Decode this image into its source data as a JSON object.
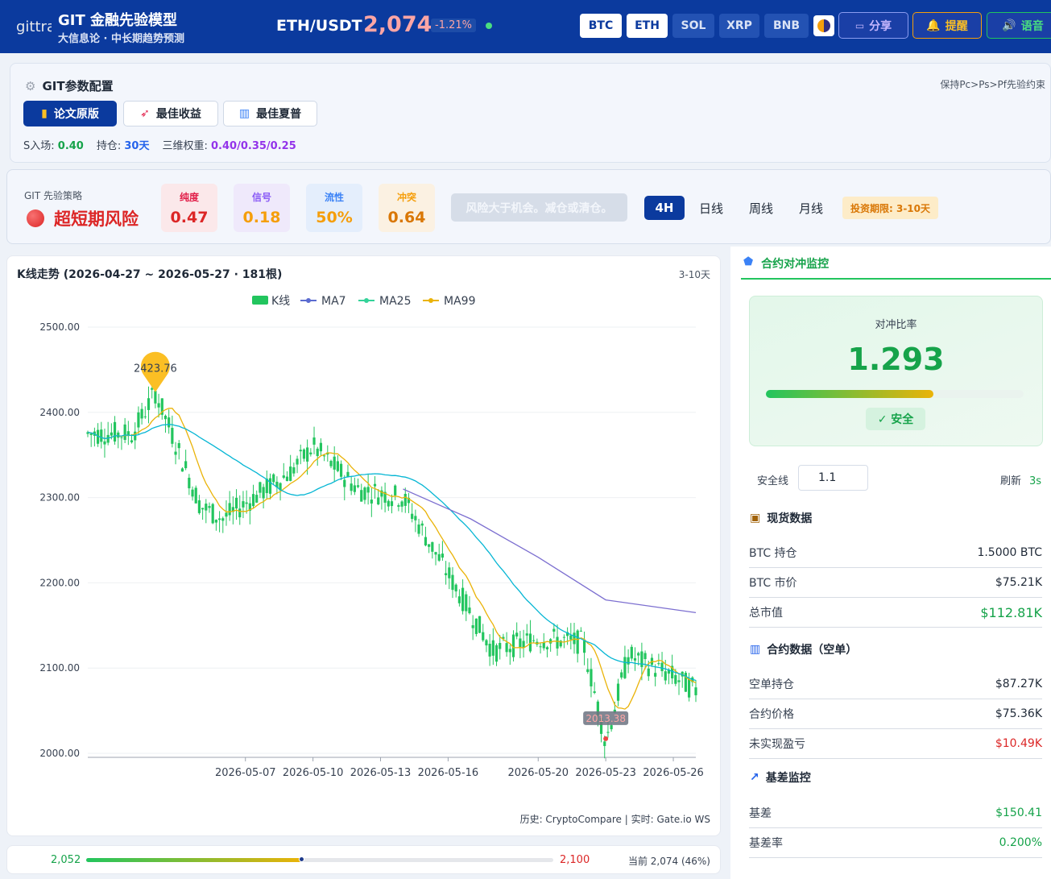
{
  "header": {
    "logo": "gittrade",
    "title": "GIT 金融先验模型",
    "subtitle": "大信息论 · 中长期趋势预测",
    "pair": "ETH/USDT",
    "price": "2,074",
    "change": "-1.21%",
    "coins": [
      "BTC",
      "ETH",
      "SOL",
      "XRP",
      "BNB"
    ],
    "active_coin": "ETH",
    "share_label": "分享",
    "alert_label": "提醒",
    "voice_label": "语音"
  },
  "config": {
    "title": "GIT参数配置",
    "note": "保持Pc>Ps>Pf先验约束",
    "presets": [
      "论文原版",
      "最佳收益",
      "最佳夏普"
    ],
    "params": {
      "entry_label": "S入场:",
      "entry_value": "0.40",
      "hold_label": "持仓:",
      "hold_value": "30天",
      "weight_label": "三维权重:",
      "weight_value": "0.40/0.35/0.25"
    }
  },
  "strategy": {
    "label": "GIT 先验策略",
    "value": "超短期风险",
    "metrics": [
      {
        "label": "纯度",
        "value": "0.47"
      },
      {
        "label": "信号",
        "value": "0.18"
      },
      {
        "label": "流性",
        "value": "50%"
      },
      {
        "label": "冲突",
        "value": "0.64"
      }
    ],
    "advice": "风险大于机会。减仓或清仓。",
    "timeframes": [
      "4H",
      "日线",
      "周线",
      "月线"
    ],
    "active_timeframe": "4H",
    "horizon": "投资期限: 3-10天"
  },
  "chart": {
    "title": "K线走势 (2026-04-27 ~ 2026-05-27 · 181根)",
    "range_tag": "3-10天",
    "source": "历史: CryptoCompare | 实时: Gate.io WS"
  },
  "chart_data": {
    "type": "candlestick",
    "legend": [
      "K线",
      "MA7",
      "MA25",
      "MA99"
    ],
    "colors": {
      "up": "#22c55e",
      "down": "#22c55e",
      "ma7": "#eab308",
      "ma25": "#06b6d4",
      "ma99": "#7c6fd0",
      "max_marker": "#fbbf24"
    },
    "ylim": [
      2000,
      2500
    ],
    "yticks": [
      "2000.00",
      "2100.00",
      "2200.00",
      "2300.00",
      "2400.00",
      "2500.00"
    ],
    "xticks": [
      "2026-05-07",
      "2026-05-10",
      "2026-05-13",
      "2026-05-16",
      "2026-05-20",
      "2026-05-23",
      "2026-05-26"
    ],
    "max_label": "2423.76",
    "min_label": "2013.38",
    "key_points": [
      {
        "t": "2026-05-02",
        "close": 2375
      },
      {
        "t": "2026-05-03",
        "close": 2423.76
      },
      {
        "t": "2026-05-05",
        "close": 2290
      },
      {
        "t": "2026-05-06",
        "close": 2275
      },
      {
        "t": "2026-05-09",
        "close": 2330
      },
      {
        "t": "2026-05-10",
        "close": 2360
      },
      {
        "t": "2026-05-12",
        "close": 2310
      },
      {
        "t": "2026-05-14",
        "close": 2300
      },
      {
        "t": "2026-05-16",
        "close": 2210
      },
      {
        "t": "2026-05-18",
        "close": 2120
      },
      {
        "t": "2026-05-20",
        "close": 2135
      },
      {
        "t": "2026-05-22",
        "close": 2130
      },
      {
        "t": "2026-05-23",
        "close": 2013.38
      },
      {
        "t": "2026-05-24",
        "close": 2115
      },
      {
        "t": "2026-05-26",
        "close": 2090
      },
      {
        "t": "2026-05-27",
        "close": 2074
      }
    ],
    "ma99_points": [
      {
        "t": "2026-05-14",
        "value": 2310
      },
      {
        "t": "2026-05-17",
        "value": 2275
      },
      {
        "t": "2026-05-20",
        "value": 2230
      },
      {
        "t": "2026-05-23",
        "value": 2180
      },
      {
        "t": "2026-05-27",
        "value": 2165
      }
    ]
  },
  "range_bar": {
    "low": "2,052",
    "high": "2,100",
    "current": "当前 2,074 (46%)",
    "fraction": 0.46
  },
  "hedge": {
    "title": "合约对冲监控",
    "ratio_label": "对冲比率",
    "ratio_value": "1.293",
    "ratio_fill": 0.65,
    "status": "✓ 安全",
    "safe_label": "安全线",
    "safe_value": "1.1",
    "refresh_label": "刷新",
    "refresh_value": "3s"
  },
  "spot": {
    "title": "现货数据",
    "rows": [
      {
        "k": "BTC 持仓",
        "v": "1.5000 BTC"
      },
      {
        "k": "BTC 市价",
        "v": "$75.21K"
      },
      {
        "k": "总市值",
        "v": "$112.81K"
      }
    ]
  },
  "contract": {
    "title": "合约数据（空单）",
    "rows": [
      {
        "k": "空单持仓",
        "v": "$87.27K"
      },
      {
        "k": "合约价格",
        "v": "$75.36K"
      },
      {
        "k": "未实现盈亏",
        "v": "$10.49K"
      }
    ]
  },
  "basis": {
    "title": "基差监控",
    "rows": [
      {
        "k": "基差",
        "v": "$150.41"
      },
      {
        "k": "基差率",
        "v": "0.200%"
      }
    ]
  }
}
